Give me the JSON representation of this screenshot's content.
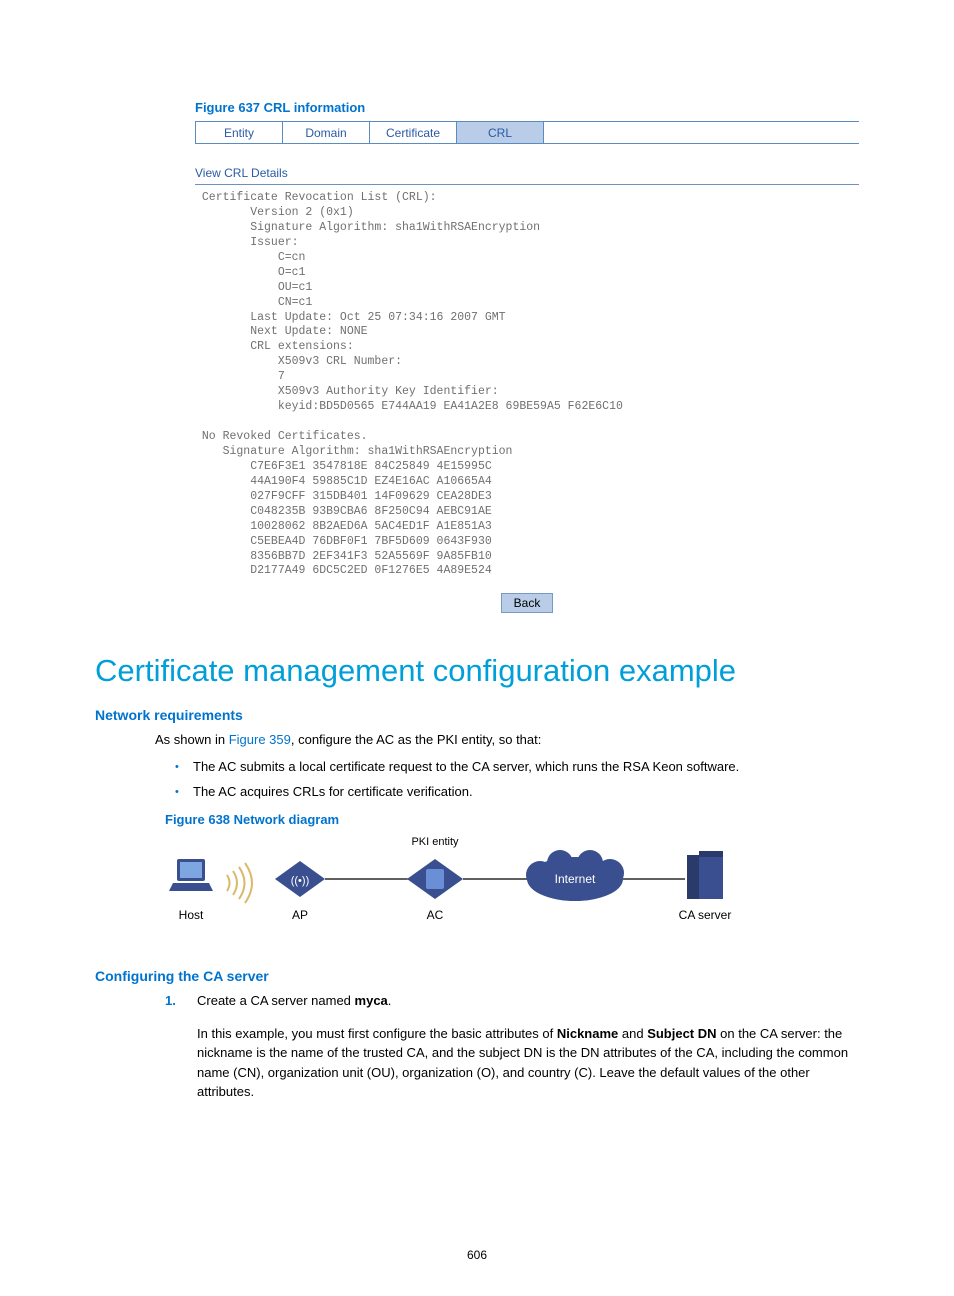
{
  "figure637": {
    "title": "Figure 637 CRL information"
  },
  "tabs": [
    "Entity",
    "Domain",
    "Certificate",
    "CRL"
  ],
  "view_details": "View CRL Details",
  "crl_text": " Certificate Revocation List (CRL):\n        Version 2 (0x1)\n        Signature Algorithm: sha1WithRSAEncryption\n        Issuer:\n            C=cn\n            O=c1\n            OU=c1\n            CN=c1\n        Last Update: Oct 25 07:34:16 2007 GMT\n        Next Update: NONE\n        CRL extensions:\n            X509v3 CRL Number:\n            7\n            X509v3 Authority Key Identifier:\n            keyid:BD5D0565 E744AA19 EA41A2E8 69BE59A5 F62E6C10\n\n No Revoked Certificates.\n    Signature Algorithm: sha1WithRSAEncryption\n        C7E6F3E1 3547818E 84C25849 4E15995C\n        44A190F4 59885C1D EZ4E16AC A10665A4\n        027F9CFF 315DB401 14F09629 CEA28DE3\n        C048235B 93B9CBA6 8F250C94 AEBC91AE\n        10028062 8B2AED6A 5AC4ED1F A1E851A3\n        C5EBEA4D 76DBF0F1 7BF5D609 0643F930\n        8356BB7D 2EF341F3 52A5569F 9A85FB10\n        D2177A49 6DC5C2ED 0F1276E5 4A89E524",
  "back_label": "Back",
  "section_title": "Certificate management configuration example",
  "network": {
    "heading": "Network requirements",
    "intro_prefix": "As shown in ",
    "intro_ref": "Figure 359",
    "intro_suffix": ", configure the AC as the PKI entity, so that:",
    "bullets": [
      "The AC submits a local certificate request to the CA server, which runs the RSA Keon software.",
      "The AC acquires CRLs for certificate verification."
    ]
  },
  "figure638": {
    "title": "Figure 638 Network diagram"
  },
  "diagram": {
    "pki": "PKI entity",
    "internet": "Internet",
    "host": "Host",
    "ap": "AP",
    "ac": "AC",
    "ca": "CA server"
  },
  "configure": {
    "heading": "Configuring the CA server",
    "step_num": "1.",
    "step_title_prefix": "Create a CA server named ",
    "step_title_bold": "myca",
    "step_title_suffix": ".",
    "step_body_1": "In this example, you must first configure the basic attributes of ",
    "nickname": "Nickname",
    "step_body_2": " and ",
    "subjectdn": "Subject DN",
    "step_body_3": " on the CA server: the nickname is the name of the trusted CA, and the subject DN is the DN attributes of the CA, including the common name (CN), organization unit (OU), organization (O), and country (C). Leave the default values of the other attributes."
  },
  "page_number": "606"
}
